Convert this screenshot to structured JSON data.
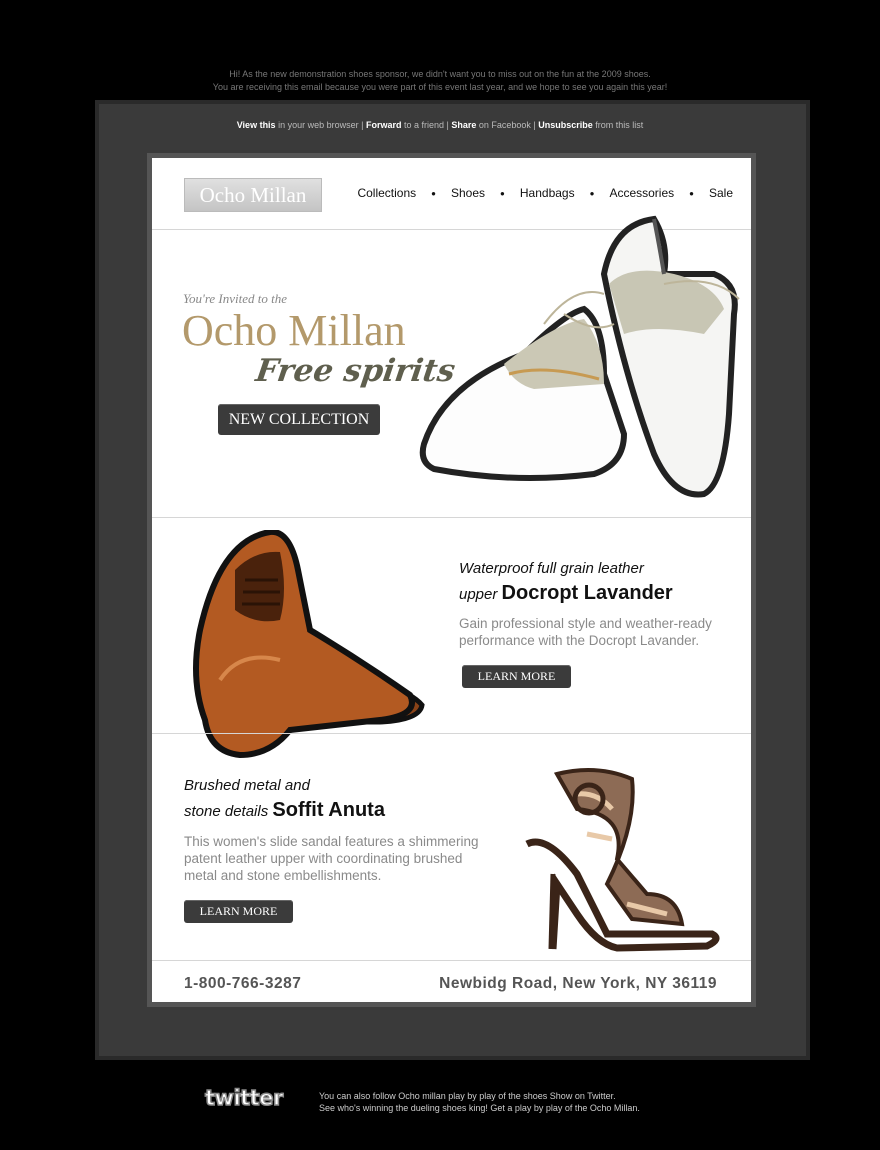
{
  "top_note": {
    "line1": "Hi! As the new demonstration shoes sponsor, we didn't want you to miss out on the fun at the 2009 shoes.",
    "line2": "You are receiving this email because you were part of this event last year, and we hope to see you again this year!"
  },
  "links": {
    "view_this": "View this",
    "view_rest": " in your web browser | ",
    "forward": "Forward",
    "forward_rest": " to a friend | ",
    "share": "Share",
    "share_rest": " on Facebook | ",
    "unsubscribe": "Unsubscribe",
    "unsubscribe_rest": " from this list"
  },
  "logo": "Ocho Millan",
  "nav": [
    "Collections",
    "Shoes",
    "Handbags",
    "Accessories",
    "Sale"
  ],
  "hero": {
    "invited": "You're Invited to the",
    "title": "Ocho Millan",
    "script": "Free spirits",
    "button": "NEW COLLECTION"
  },
  "product1": {
    "italic1": "Waterproof full grain leather",
    "italic2": "upper ",
    "name": "Docropt Lavander",
    "desc1": "Gain professional style and weather-ready",
    "desc2": "performance with the Docropt Lavander.",
    "button": "LEARN MORE"
  },
  "product2": {
    "italic1": "Brushed metal and",
    "italic2": "stone details ",
    "name": "Soffit Anuta",
    "desc1": "This women's slide sandal features a shimmering",
    "desc2": "patent leather upper with coordinating brushed",
    "desc3": "metal and stone embellishments.",
    "button": "LEARN MORE"
  },
  "footer": {
    "phone": "1-800-766-3287",
    "address": "Newbidg Road, New  York, NY  36119"
  },
  "twitter": {
    "logo": "twitter",
    "line1": "You can also follow Ocho millan play by play of the shoes Show on Twitter.",
    "line2": "See who's winning the dueling shoes king! Get a play by play of the Ocho Millan."
  },
  "colors": {
    "accent_gold": "#b3996b",
    "button_dark": "#3b3b3b",
    "outer_frame": "#3a3a3a"
  }
}
